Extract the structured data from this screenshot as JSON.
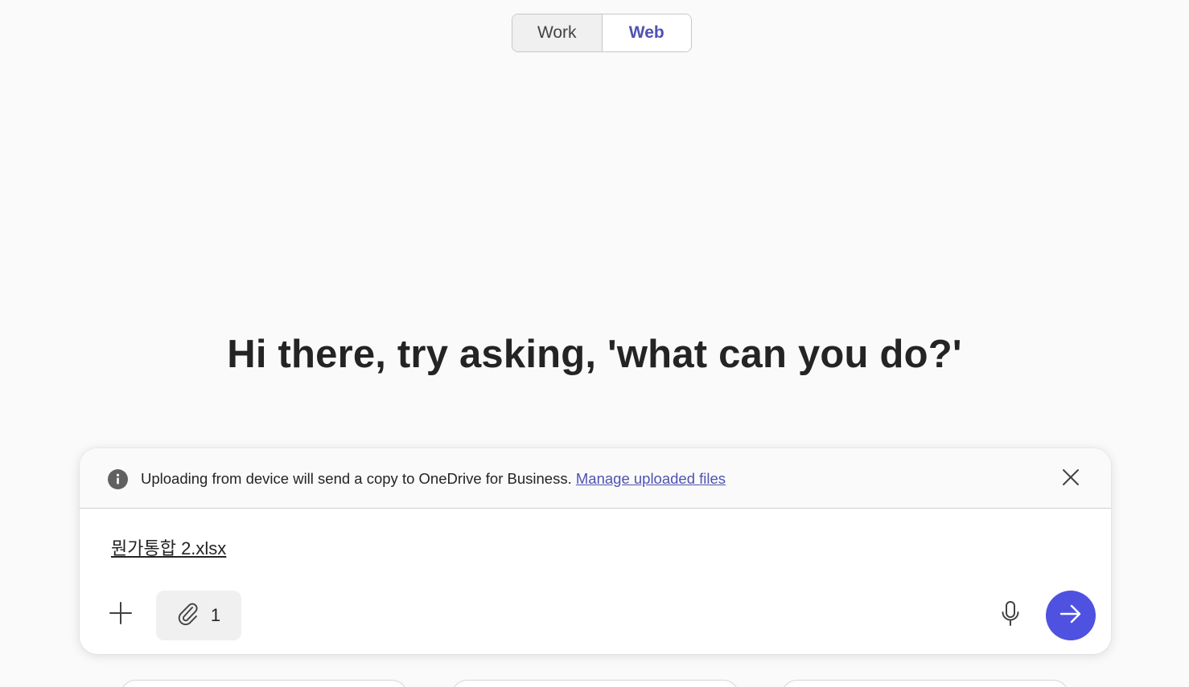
{
  "toggle": {
    "options": [
      {
        "label": "Work",
        "selected": false
      },
      {
        "label": "Web",
        "selected": true
      }
    ],
    "accent_color": "#4f52b2"
  },
  "greeting": "Hi there, try asking, 'what can you do?'",
  "composer": {
    "notice": {
      "icon": "info-icon",
      "text": "Uploading from device will send a copy to OneDrive for Business.",
      "link_label": "Manage uploaded files",
      "close_icon": "close-icon"
    },
    "attached_file": "뭔가통합 2.xlsx",
    "toolbar": {
      "add_icon": "plus-icon",
      "attach_icon": "paperclip-icon",
      "attachment_count": "1",
      "mic_icon": "microphone-icon",
      "send_icon": "arrow-right-icon",
      "send_color": "#4f52e0"
    }
  }
}
